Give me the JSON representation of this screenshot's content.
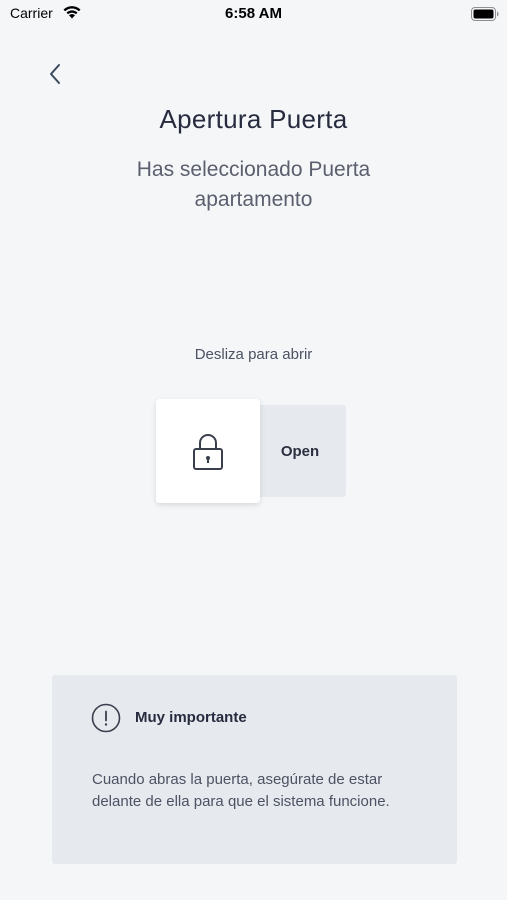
{
  "status_bar": {
    "carrier": "Carrier",
    "time": "6:58 AM",
    "wifi_icon": "wifi-icon",
    "battery_icon": "battery-icon"
  },
  "header": {
    "back_icon": "chevron-left-icon",
    "title": "Apertura Puerta",
    "subtitle": "Has seleccionado Puerta apartamento"
  },
  "slider": {
    "hint": "Desliza para abrir",
    "label": "Open",
    "handle_icon": "lock-icon"
  },
  "info": {
    "icon": "exclamation-circle-icon",
    "title": "Muy importante",
    "body": "Cuando abras la puerta, asegúrate de estar delante de ella para que el sistema funcione."
  },
  "colors": {
    "background": "#f4f6f8",
    "card": "#e6eaee",
    "text_primary": "#262b3e",
    "text_secondary": "#5b5f6e"
  }
}
